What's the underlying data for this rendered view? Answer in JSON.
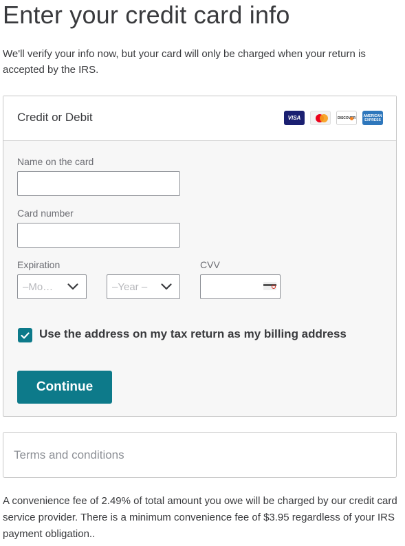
{
  "page": {
    "title": "Enter your credit card info",
    "intro": "We'll verify your info now, but your card will only be charged when your return is accepted by the IRS."
  },
  "card_panel": {
    "header_title": "Credit or Debit",
    "brands": [
      {
        "name": "visa-logo",
        "text": "VISA"
      },
      {
        "name": "mastercard-logo",
        "text": ""
      },
      {
        "name": "discover-logo",
        "text": "DISCOVER"
      },
      {
        "name": "amex-logo",
        "text_line1": "AMERICAN",
        "text_line2": "EXPRESS"
      }
    ],
    "name_label": "Name on the card",
    "name_value": "",
    "number_label": "Card number",
    "number_value": "",
    "expiration_label": "Expiration",
    "month_placeholder": "–Mo…",
    "year_placeholder": "–Year –",
    "cvv_label": "CVV",
    "cvv_value": "",
    "billing_checkbox_checked": true,
    "billing_checkbox_label": "Use the address on my tax return as my billing address",
    "continue_label": "Continue"
  },
  "terms": {
    "label": "Terms and conditions"
  },
  "fee_notice": "A convenience fee of 2.49% of total amount you owe will be charged by our credit card service provider. There is a minimum convenience fee of $3.95 regardless of your IRS payment obligation..",
  "colors": {
    "accent": "#0d7a8a",
    "text": "#393a3d",
    "muted": "#8d9096"
  }
}
